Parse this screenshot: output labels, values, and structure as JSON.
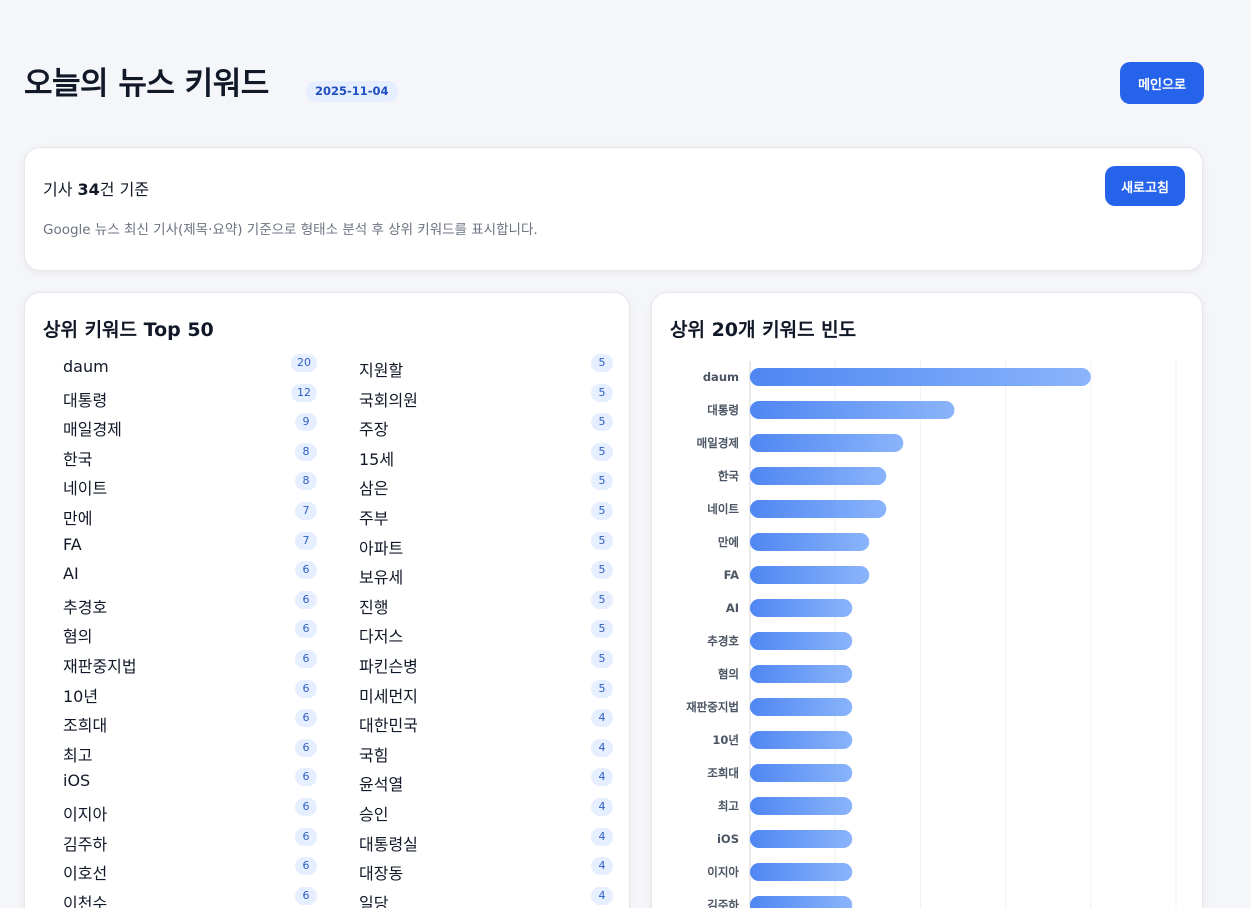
{
  "header": {
    "title": "오늘의 뉴스 키워드",
    "date": "2025-11-04",
    "main_button": "메인으로"
  },
  "summary": {
    "count_prefix": "기사 ",
    "count_value": "34",
    "count_suffix": "건 기준",
    "description": "Google 뉴스 최신 기사(제목·요약) 기준으로 형태소 분석 후 상위 키워드를 표시합니다.",
    "refresh_button": "새로고침"
  },
  "keyword_list": {
    "title": "상위 키워드 Top 50",
    "items": [
      {
        "keyword": "daum",
        "count": "20"
      },
      {
        "keyword": "대통령",
        "count": "12"
      },
      {
        "keyword": "매일경제",
        "count": "9"
      },
      {
        "keyword": "한국",
        "count": "8"
      },
      {
        "keyword": "네이트",
        "count": "8"
      },
      {
        "keyword": "만에",
        "count": "7"
      },
      {
        "keyword": "FA",
        "count": "7"
      },
      {
        "keyword": "AI",
        "count": "6"
      },
      {
        "keyword": "추경호",
        "count": "6"
      },
      {
        "keyword": "혐의",
        "count": "6"
      },
      {
        "keyword": "재판중지법",
        "count": "6"
      },
      {
        "keyword": "10년",
        "count": "6"
      },
      {
        "keyword": "조희대",
        "count": "6"
      },
      {
        "keyword": "최고",
        "count": "6"
      },
      {
        "keyword": "iOS",
        "count": "6"
      },
      {
        "keyword": "이지아",
        "count": "6"
      },
      {
        "keyword": "김주하",
        "count": "6"
      },
      {
        "keyword": "이호선",
        "count": "6"
      },
      {
        "keyword": "이천수",
        "count": "6"
      },
      {
        "keyword": "지원할",
        "count": "5"
      },
      {
        "keyword": "국회의원",
        "count": "5"
      },
      {
        "keyword": "주장",
        "count": "5"
      },
      {
        "keyword": "15세",
        "count": "5"
      },
      {
        "keyword": "삼은",
        "count": "5"
      },
      {
        "keyword": "주부",
        "count": "5"
      },
      {
        "keyword": "아파트",
        "count": "5"
      },
      {
        "keyword": "보유세",
        "count": "5"
      },
      {
        "keyword": "진행",
        "count": "5"
      },
      {
        "keyword": "다저스",
        "count": "5"
      },
      {
        "keyword": "파킨슨병",
        "count": "5"
      },
      {
        "keyword": "미세먼지",
        "count": "5"
      },
      {
        "keyword": "대한민국",
        "count": "4"
      },
      {
        "keyword": "국힘",
        "count": "4"
      },
      {
        "keyword": "윤석열",
        "count": "4"
      },
      {
        "keyword": "승인",
        "count": "4"
      },
      {
        "keyword": "대통령실",
        "count": "4"
      },
      {
        "keyword": "대장동",
        "count": "4"
      },
      {
        "keyword": "일당",
        "count": "4"
      }
    ]
  },
  "chart_card": {
    "title": "상위 20개 키워드 빈도"
  },
  "chart_data": {
    "type": "bar",
    "orientation": "horizontal",
    "categories": [
      "daum",
      "대통령",
      "매일경제",
      "한국",
      "네이트",
      "만에",
      "FA",
      "AI",
      "추경호",
      "혐의",
      "재판중지법",
      "10년",
      "조희대",
      "최고",
      "iOS",
      "이지아",
      "김주하"
    ],
    "values": [
      20,
      12,
      9,
      8,
      8,
      7,
      7,
      6,
      6,
      6,
      6,
      6,
      6,
      6,
      6,
      6,
      6
    ],
    "xlim": [
      0,
      25
    ],
    "grid": true,
    "colors": {
      "bar_start": "#4f86f2",
      "bar_end": "#8ab4fb",
      "grid": "#eef0f4",
      "axis": "#d1d5db"
    }
  }
}
